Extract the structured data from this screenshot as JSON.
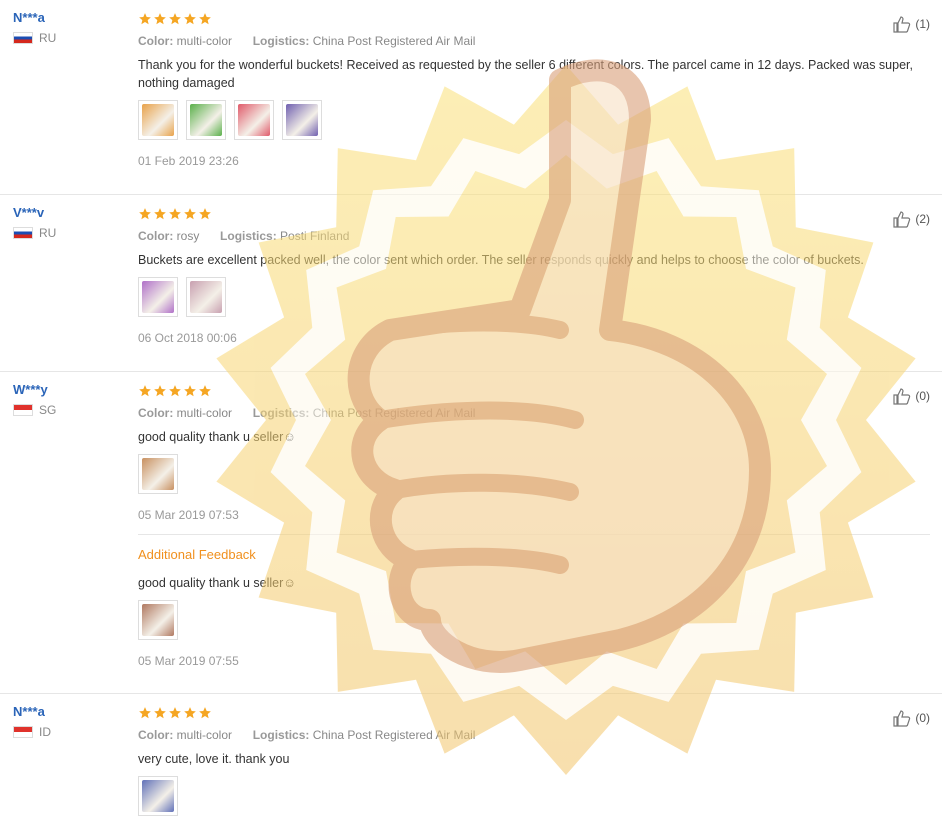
{
  "reviews": [
    {
      "user": "N***a",
      "country": "RU",
      "stars": 5,
      "color_label": "Color:",
      "color_value": "multi-color",
      "logistics_label": "Logistics:",
      "logistics_value": "China Post Registered Air Mail",
      "text": "Thank you for the wonderful buckets! Received as requested by the seller 6 different colors. The parcel came in 12 days. Packed was super, nothing damaged",
      "photos": [
        "#e8a24a",
        "#5ab04a",
        "#e05a6a",
        "#7060b0"
      ],
      "date": "01 Feb 2019 23:26",
      "helpful": "(1)"
    },
    {
      "user": "V***v",
      "country": "RU",
      "stars": 5,
      "color_label": "Color:",
      "color_value": "rosy",
      "logistics_label": "Logistics:",
      "logistics_value": "Posti Finland",
      "text": "Buckets are excellent packed well, the color sent which order. The seller responds quickly and helps to choose the color of buckets.",
      "photos": [
        "#b070c8",
        "#c8a0b0"
      ],
      "date": "06 Oct 2018 00:06",
      "helpful": "(2)"
    },
    {
      "user": "W***y",
      "country": "SG",
      "stars": 5,
      "color_label": "Color:",
      "color_value": "multi-color",
      "logistics_label": "Logistics:",
      "logistics_value": "China Post Registered Air Mail",
      "text": "good quality thank u seller☺",
      "photos": [
        "#c89060"
      ],
      "date": "05 Mar 2019 07:53",
      "additional_title": "Additional Feedback",
      "additional_text": "good quality thank u seller☺",
      "additional_photos": [
        "#b07860"
      ],
      "additional_date": "05 Mar 2019 07:55",
      "helpful": "(0)"
    },
    {
      "user": "N***a",
      "country": "ID",
      "stars": 5,
      "color_label": "Color:",
      "color_value": "multi-color",
      "logistics_label": "Logistics:",
      "logistics_value": "China Post Registered Air Mail",
      "text": "very cute, love it. thank you",
      "photos": [
        "#6070b8"
      ],
      "date": "",
      "helpful": "(0)"
    }
  ],
  "colors": {
    "username": "#2a64b8",
    "star": "#f5a623",
    "additional_feedback": "#f0901e",
    "watermark_badge": "#f6d04a",
    "watermark_thumb": "#d9a07a"
  }
}
